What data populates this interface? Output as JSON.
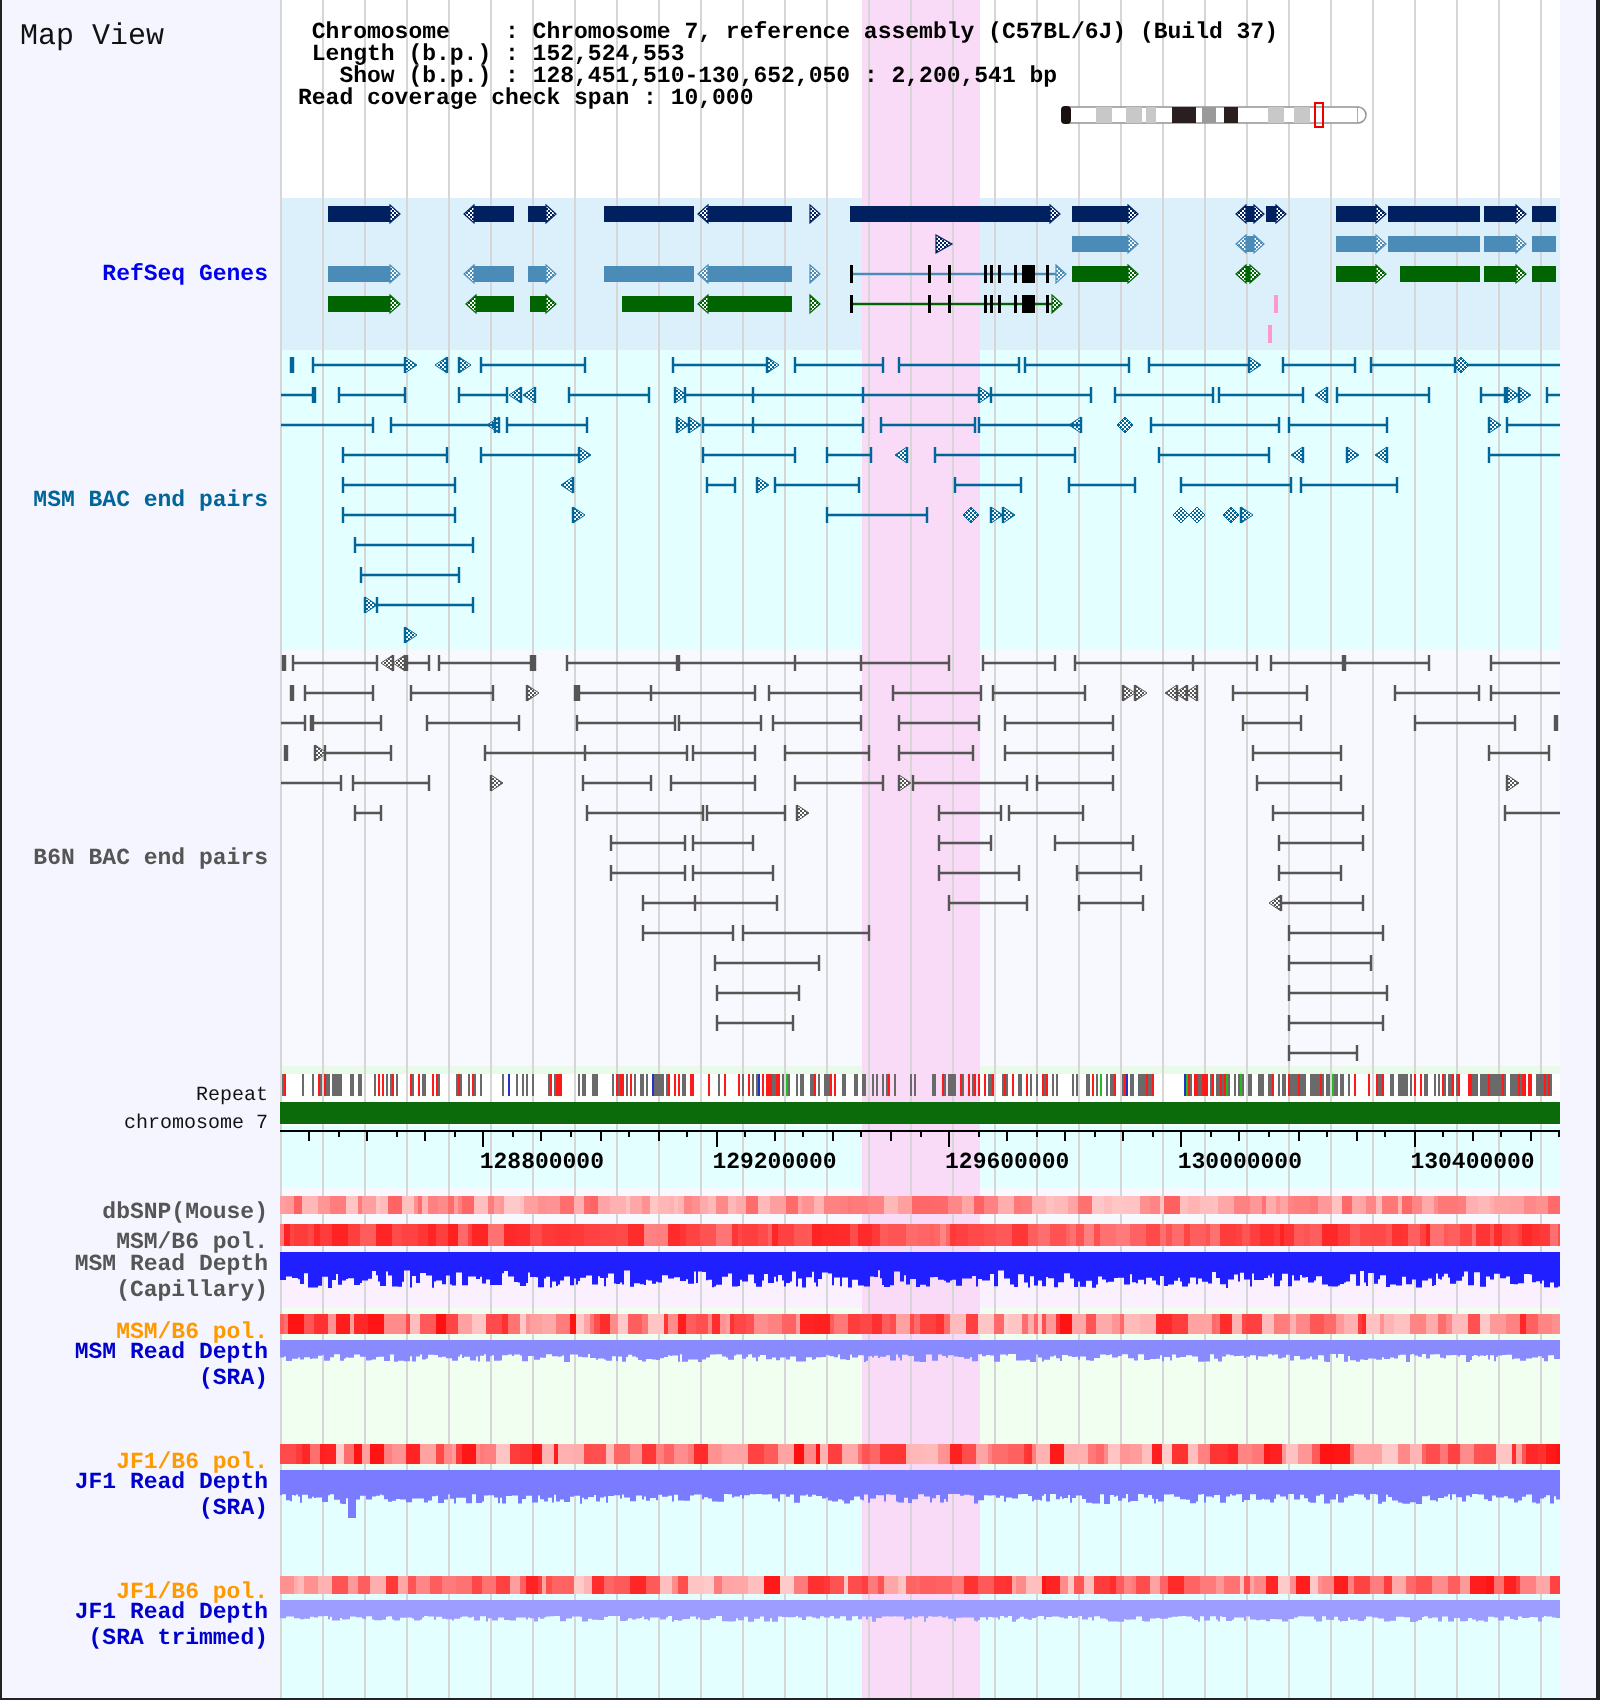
{
  "title": "Map View",
  "info": [
    "Chromosome    : Chromosome 7, reference assembly (C57BL/6J) (Build 37)",
    "Length (b.p.) : 152,524,553",
    "Show (b.p.) : 128,451,510-130,652,050 : 2,200,541 bp",
    "Read coverage check span : 10,000"
  ],
  "tracks": [
    {
      "kind": "genes",
      "label": "RefSeq Genes",
      "color": "#0000ee"
    },
    {
      "kind": "bac_pairs",
      "label": "MSM BAC end pairs",
      "color": "#006699"
    },
    {
      "kind": "bac_pairs",
      "label": "B6N BAC end pairs",
      "color": "#555555"
    },
    {
      "kind": "repeat",
      "label": "Repeat"
    },
    {
      "kind": "chromosome",
      "label": "chromosome 7"
    },
    {
      "kind": "ruler",
      "labels": [
        "128800000",
        "129200000",
        "129600000",
        "130000000",
        "130400000"
      ]
    },
    {
      "kind": "snp",
      "label": "dbSNP(Mouse)",
      "color": "#555555"
    },
    {
      "kind": "polymorphism",
      "label": "MSM/B6 pol.",
      "color": "#555555"
    },
    {
      "kind": "read_depth",
      "label": "MSM Read Depth (Capillary)",
      "color": "#555555"
    },
    {
      "kind": "polymorphism",
      "label": "MSM/B6 pol.",
      "color": "#ff9900"
    },
    {
      "kind": "read_depth",
      "label": "MSM Read Depth (SRA)",
      "color": "#0000cc"
    },
    {
      "kind": "polymorphism",
      "label": "JF1/B6 pol.",
      "color": "#ff9900"
    },
    {
      "kind": "read_depth",
      "label": "JF1 Read Depth (SRA)",
      "color": "#0000cc"
    },
    {
      "kind": "polymorphism",
      "label": "JF1/B6 pol.",
      "color": "#ff9900"
    },
    {
      "kind": "read_depth",
      "label": "JF1 Read Depth (SRA trimmed)",
      "color": "#0000cc"
    }
  ]
}
